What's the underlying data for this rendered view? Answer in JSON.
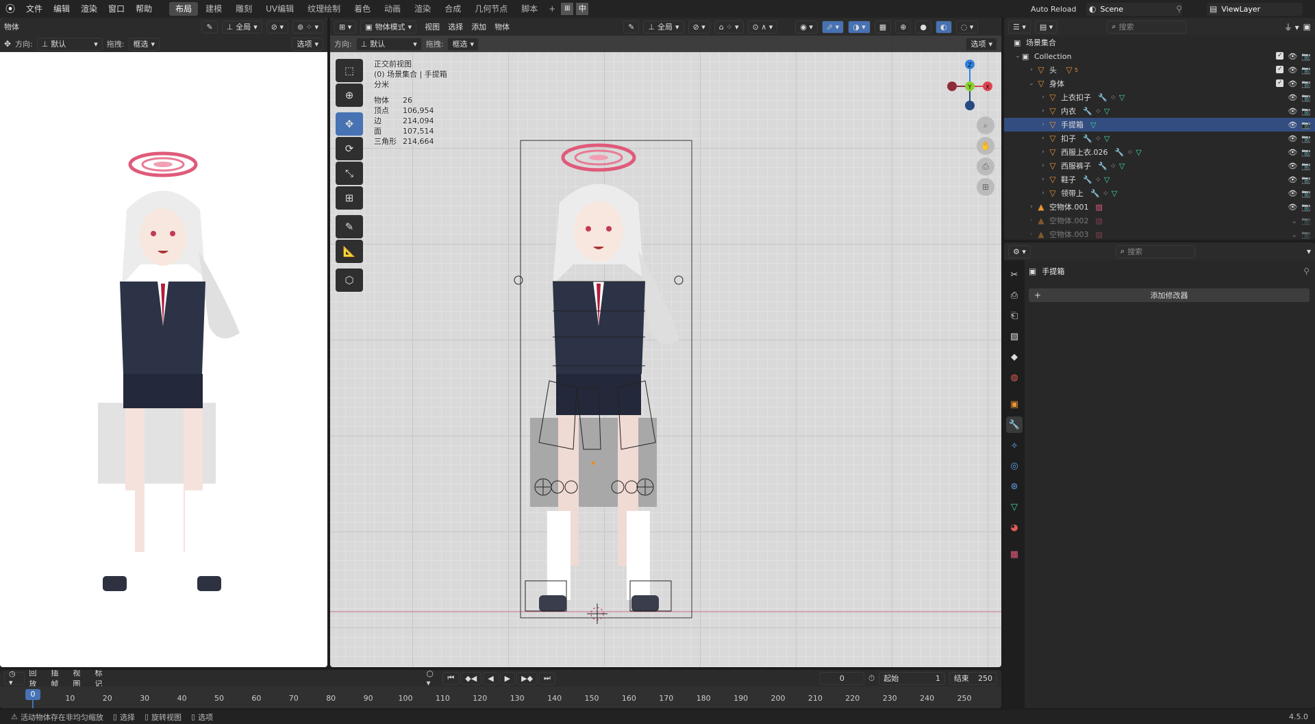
{
  "topbar": {
    "logo": "blender-logo-icon",
    "menus": [
      "文件",
      "编辑",
      "渲染",
      "窗口",
      "帮助"
    ],
    "workspaces": [
      "布局",
      "建模",
      "雕刻",
      "UV编辑",
      "纹理绘制",
      "着色",
      "动画",
      "渲染",
      "合成",
      "几何节点",
      "脚本"
    ],
    "active_workspace": "布局",
    "ime_a": "中",
    "auto_reload": "Auto Reload",
    "scene": "Scene",
    "view_layer": "ViewLayer"
  },
  "left_view": {
    "mode": "物体",
    "orient_label": "方向:",
    "orient_value": "默认",
    "drag_label": "拖拽:",
    "drag_value": "框选",
    "options": "选项",
    "global": "全局"
  },
  "main_view": {
    "mode": "物体模式",
    "menus": [
      "视图",
      "选择",
      "添加",
      "物体"
    ],
    "orient_label": "方向:",
    "orient_value": "默认",
    "drag_label": "拖拽:",
    "drag_value": "框选",
    "options": "选项",
    "global": "全局",
    "overlay_title": "正交前视图",
    "overlay_sub": "(0) 场景集合 | 手提箱",
    "overlay_unit": "分米",
    "stats": [
      {
        "k": "物体",
        "v": "26"
      },
      {
        "k": "顶点",
        "v": "106,954"
      },
      {
        "k": "边",
        "v": "214,094"
      },
      {
        "k": "面",
        "v": "107,514"
      },
      {
        "k": "三角形",
        "v": "214,664"
      }
    ],
    "gizmo": {
      "z": "Z",
      "y": "Y",
      "x": "X"
    }
  },
  "outliner": {
    "search": "搜索",
    "root": "场景集合",
    "collection": "Collection",
    "items": [
      {
        "name": "头",
        "depth": 2,
        "type": "mesh",
        "exp": false,
        "children_count": "5"
      },
      {
        "name": "身体",
        "depth": 2,
        "type": "mesh",
        "exp": true
      },
      {
        "name": "上衣扣子",
        "depth": 3,
        "type": "mesh"
      },
      {
        "name": "内衣",
        "depth": 3,
        "type": "mesh"
      },
      {
        "name": "手提箱",
        "depth": 3,
        "type": "mesh",
        "active": true
      },
      {
        "name": "扣子",
        "depth": 3,
        "type": "mesh"
      },
      {
        "name": "西服上衣.026",
        "depth": 3,
        "type": "mesh"
      },
      {
        "name": "西服裤子",
        "depth": 3,
        "type": "mesh"
      },
      {
        "name": "鞋子",
        "depth": 3,
        "type": "mesh"
      },
      {
        "name": "领带上",
        "depth": 3,
        "type": "mesh"
      },
      {
        "name": "空物体.001",
        "depth": 2,
        "type": "empty"
      },
      {
        "name": "空物体.002",
        "depth": 2,
        "type": "empty",
        "dim": true
      },
      {
        "name": "空物体.003",
        "depth": 2,
        "type": "empty",
        "dim": true
      }
    ]
  },
  "properties": {
    "search": "搜索",
    "object_name": "手提箱",
    "add_modifier": "添加修改器"
  },
  "timeline": {
    "menus": [
      "回放",
      "插帧",
      "视图",
      "标记"
    ],
    "current_frame": "0",
    "start_label": "起始",
    "start": "1",
    "end_label": "结束",
    "end": "250",
    "ticks": [
      "0",
      "10",
      "20",
      "30",
      "40",
      "50",
      "60",
      "70",
      "80",
      "90",
      "100",
      "110",
      "120",
      "130",
      "140",
      "150",
      "160",
      "170",
      "180",
      "190",
      "200",
      "210",
      "220",
      "230",
      "240",
      "250"
    ]
  },
  "status": {
    "warning": "活动物体存在非均匀缩放",
    "select": "选择",
    "rotate": "旋转视图",
    "options": "选项",
    "version": "4.5.0"
  },
  "colors": {
    "accent": "#4772b3",
    "active_tab": "#4a4a4a",
    "x_axis": "#e0434f",
    "y_axis": "#8bd12d",
    "z_axis": "#2f82e0",
    "mesh_icon": "#e89436",
    "data_icon": "#42d9a2"
  }
}
